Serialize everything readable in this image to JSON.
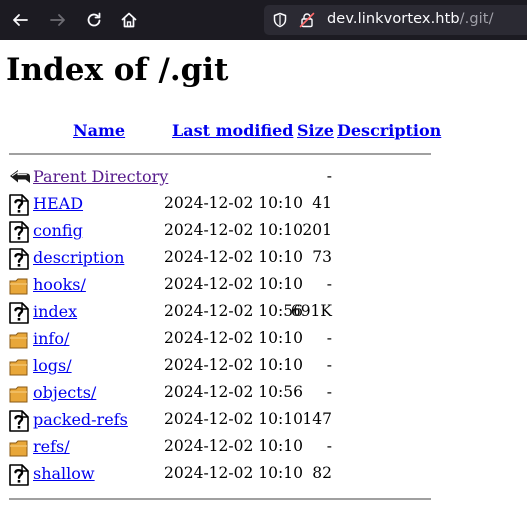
{
  "browser": {
    "url_host": "dev.linkvortex.htb",
    "url_path": "/.git/"
  },
  "page": {
    "title": "Index of /.git",
    "headers": {
      "name": "Name",
      "last_modified": "Last modified",
      "size": "Size",
      "description": "Description"
    },
    "rows": [
      {
        "icon": "back-icon",
        "name": "Parent Directory",
        "date": "",
        "size": "-"
      },
      {
        "icon": "unknown-file-icon",
        "name": "HEAD",
        "date": "2024-12-02 10:10",
        "size": "41"
      },
      {
        "icon": "unknown-file-icon",
        "name": "config",
        "date": "2024-12-02 10:10",
        "size": "201"
      },
      {
        "icon": "unknown-file-icon",
        "name": "description",
        "date": "2024-12-02 10:10",
        "size": "73"
      },
      {
        "icon": "folder-icon",
        "name": "hooks/",
        "date": "2024-12-02 10:10",
        "size": "-"
      },
      {
        "icon": "unknown-file-icon",
        "name": "index",
        "date": "2024-12-02 10:56",
        "size": "691K"
      },
      {
        "icon": "folder-icon",
        "name": "info/",
        "date": "2024-12-02 10:10",
        "size": "-"
      },
      {
        "icon": "folder-icon",
        "name": "logs/",
        "date": "2024-12-02 10:10",
        "size": "-"
      },
      {
        "icon": "folder-icon",
        "name": "objects/",
        "date": "2024-12-02 10:56",
        "size": "-"
      },
      {
        "icon": "unknown-file-icon",
        "name": "packed-refs",
        "date": "2024-12-02 10:10",
        "size": "147"
      },
      {
        "icon": "folder-icon",
        "name": "refs/",
        "date": "2024-12-02 10:10",
        "size": "-"
      },
      {
        "icon": "unknown-file-icon",
        "name": "shallow",
        "date": "2024-12-02 10:10",
        "size": "82"
      }
    ]
  },
  "colors": {
    "toolbar_bg": "#1c1b22",
    "urlbar_bg": "#2b2a33",
    "link": "#0000ee",
    "visited_link": "#551a8b",
    "folder": "#e8a73a"
  }
}
